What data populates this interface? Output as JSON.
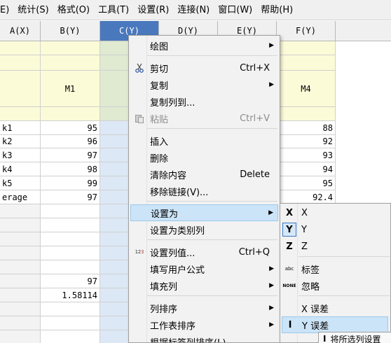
{
  "menubar": {
    "items": [
      "E)",
      "统计(S)",
      "格式(O)",
      "工具(T)",
      "设置(R)",
      "连接(N)",
      "窗口(W)",
      "帮助(H)"
    ]
  },
  "columns": [
    "A(X)",
    "B(Y)",
    "C(Y)",
    "D(Y)",
    "E(Y)",
    "F(Y)"
  ],
  "meta": {
    "longname_b": "M1",
    "longname_f": "M4"
  },
  "rows": [
    {
      "a": "k1",
      "b": "95",
      "f": "88"
    },
    {
      "a": "k2",
      "b": "96",
      "f": "92"
    },
    {
      "a": "k3",
      "b": "97",
      "f": "93"
    },
    {
      "a": "k4",
      "b": "98",
      "f": "94"
    },
    {
      "a": "k5",
      "b": "99",
      "f": "95"
    },
    {
      "a": "erage",
      "b": "97",
      "f": "92.4"
    }
  ],
  "extra_rows": [
    {
      "b": "97"
    },
    {
      "b": "1.58114"
    }
  ],
  "context_menu": {
    "items": [
      {
        "label": "绘图",
        "shortcut": "",
        "submenu": true
      },
      {
        "label": "剪切",
        "shortcut": "Ctrl+X",
        "icon": "scissors-icon"
      },
      {
        "label": "复制",
        "shortcut": "",
        "submenu": true
      },
      {
        "label": "复制列到...",
        "shortcut": ""
      },
      {
        "label": "粘贴",
        "shortcut": "Ctrl+V",
        "disabled": true,
        "icon": "paste-icon"
      },
      {
        "label": "插入",
        "shortcut": ""
      },
      {
        "label": "删除",
        "shortcut": ""
      },
      {
        "label": "清除内容",
        "shortcut": "Delete"
      },
      {
        "label": "移除链接(V)...",
        "shortcut": ""
      },
      {
        "label": "设置为",
        "shortcut": "",
        "submenu": true,
        "highlighted": true
      },
      {
        "label": "设置为类别列",
        "shortcut": ""
      },
      {
        "label": "设置列值...",
        "shortcut": "Ctrl+Q",
        "icon": "set-values-icon"
      },
      {
        "label": "填写用户公式",
        "shortcut": "",
        "submenu": true
      },
      {
        "label": "填充列",
        "shortcut": "",
        "submenu": true
      },
      {
        "label": "列排序",
        "shortcut": "",
        "submenu": true
      },
      {
        "label": "工作表排序",
        "shortcut": "",
        "submenu": true
      },
      {
        "label": "根据标签列排序(L)",
        "shortcut": ""
      }
    ]
  },
  "set_as_submenu": {
    "items": [
      {
        "label": "X",
        "icon_text": "X"
      },
      {
        "label": "Y",
        "icon_text": "Y",
        "selected": true
      },
      {
        "label": "Z",
        "icon_text": "Z"
      },
      {
        "label": "标签",
        "icon_text": "abc"
      },
      {
        "label": "忽略",
        "icon_text": "NONE"
      },
      {
        "label": "X 误差",
        "icon_text": ""
      },
      {
        "label": "Y 误差",
        "icon_text": "I",
        "highlighted": true
      }
    ]
  },
  "tooltip": {
    "text": "将所选列设置"
  }
}
